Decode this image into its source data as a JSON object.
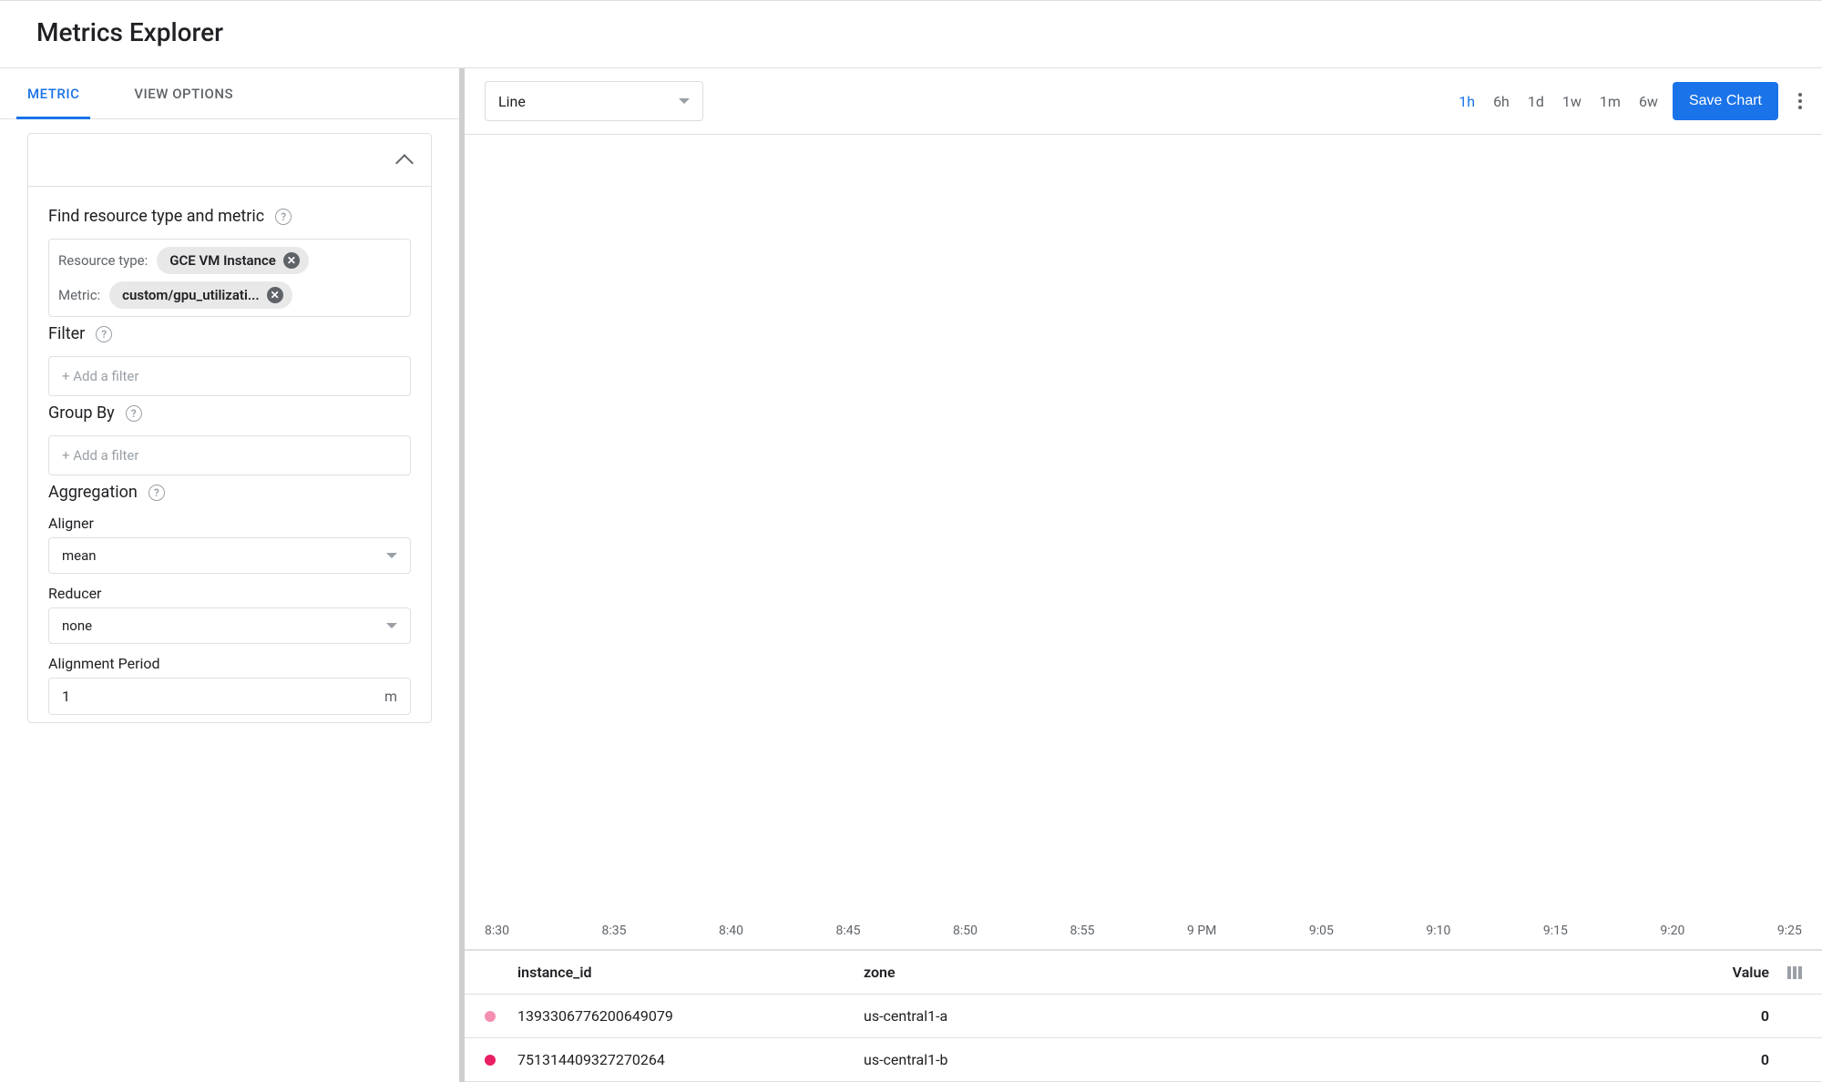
{
  "header": {
    "title": "Metrics Explorer"
  },
  "sidebar": {
    "tabs": {
      "metric": "METRIC",
      "view_options": "VIEW OPTIONS"
    },
    "find": {
      "label": "Find resource type and metric",
      "resource_type_label": "Resource type:",
      "resource_type_value": "GCE VM Instance",
      "metric_label": "Metric:",
      "metric_value": "custom/gpu_utilizati..."
    },
    "filter": {
      "label": "Filter",
      "placeholder": "+ Add a filter"
    },
    "group_by": {
      "label": "Group By",
      "placeholder": "+ Add a filter"
    },
    "aggregation": {
      "label": "Aggregation",
      "aligner_label": "Aligner",
      "aligner_value": "mean",
      "reducer_label": "Reducer",
      "reducer_value": "none",
      "alignment_period_label": "Alignment Period",
      "alignment_period_value": "1",
      "alignment_period_unit": "m"
    }
  },
  "toolbar": {
    "chart_type": "Line",
    "time_ranges": [
      "1h",
      "6h",
      "1d",
      "1w",
      "1m",
      "6w"
    ],
    "time_active": "1h",
    "save_label": "Save Chart"
  },
  "chart_data": {
    "type": "line",
    "x_ticks": [
      "8:30",
      "8:35",
      "8:40",
      "8:45",
      "8:50",
      "8:55",
      "9 PM",
      "9:05",
      "9:10",
      "9:15",
      "9:20",
      "9:25"
    ],
    "series": [
      {
        "name": "1393306776200649079",
        "color": "#ec407a",
        "values": []
      },
      {
        "name": "751314409327270264",
        "color": "#e91e63",
        "values": []
      }
    ]
  },
  "legend": {
    "columns": {
      "instance_id": "instance_id",
      "zone": "zone",
      "value": "Value"
    },
    "rows": [
      {
        "swatch": "#f48fb1",
        "instance_id": "1393306776200649079",
        "zone": "us-central1-a",
        "value": "0"
      },
      {
        "swatch": "#e91e63",
        "instance_id": "751314409327270264",
        "zone": "us-central1-b",
        "value": "0"
      }
    ]
  }
}
